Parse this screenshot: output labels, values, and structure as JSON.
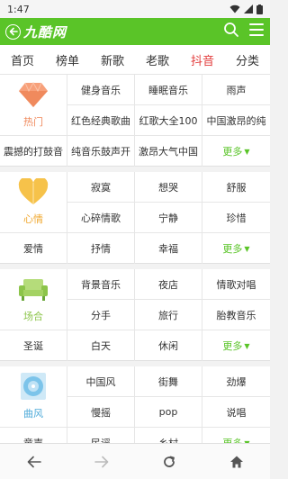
{
  "status": {
    "time": "1:47"
  },
  "header": {
    "title": "九酷网"
  },
  "nav": {
    "tabs": [
      "首页",
      "榜单",
      "新歌",
      "老歌",
      "抖音",
      "分类"
    ],
    "active_index": 4
  },
  "colors": {
    "accent": "#5ac428",
    "active_tab": "#e23b3b"
  },
  "sections": [
    {
      "label": "热门",
      "icon": "diamond-icon",
      "label_color": "#f08a5d",
      "rows": [
        [
          "健身音乐",
          "睡眠音乐",
          "雨声"
        ],
        [
          "红色经典歌曲",
          "红歌大全100",
          "中国激昂的纯"
        ],
        [
          "震撼的打鼓音",
          "纯音乐鼓声开",
          "激昂大气中国",
          "更多"
        ]
      ]
    },
    {
      "label": "心情",
      "icon": "heart-icon",
      "label_color": "#f0a830",
      "rows": [
        [
          "寂寞",
          "想哭",
          "舒服"
        ],
        [
          "心碎情歌",
          "宁静",
          "珍惜"
        ],
        [
          "爱情",
          "抒情",
          "幸福",
          "更多"
        ]
      ]
    },
    {
      "label": "场合",
      "icon": "sofa-icon",
      "label_color": "#8cc44a",
      "rows": [
        [
          "背景音乐",
          "夜店",
          "情歌对唱"
        ],
        [
          "分手",
          "旅行",
          "胎教音乐"
        ],
        [
          "圣诞",
          "白天",
          "休闲",
          "更多"
        ]
      ]
    },
    {
      "label": "曲风",
      "icon": "disc-icon",
      "label_color": "#4aa8d8",
      "rows": [
        [
          "中国风",
          "街舞",
          "劲爆"
        ],
        [
          "慢摇",
          "pop",
          "说唱"
        ],
        [
          "童声",
          "民谣",
          "乡村",
          "更多"
        ]
      ]
    }
  ]
}
